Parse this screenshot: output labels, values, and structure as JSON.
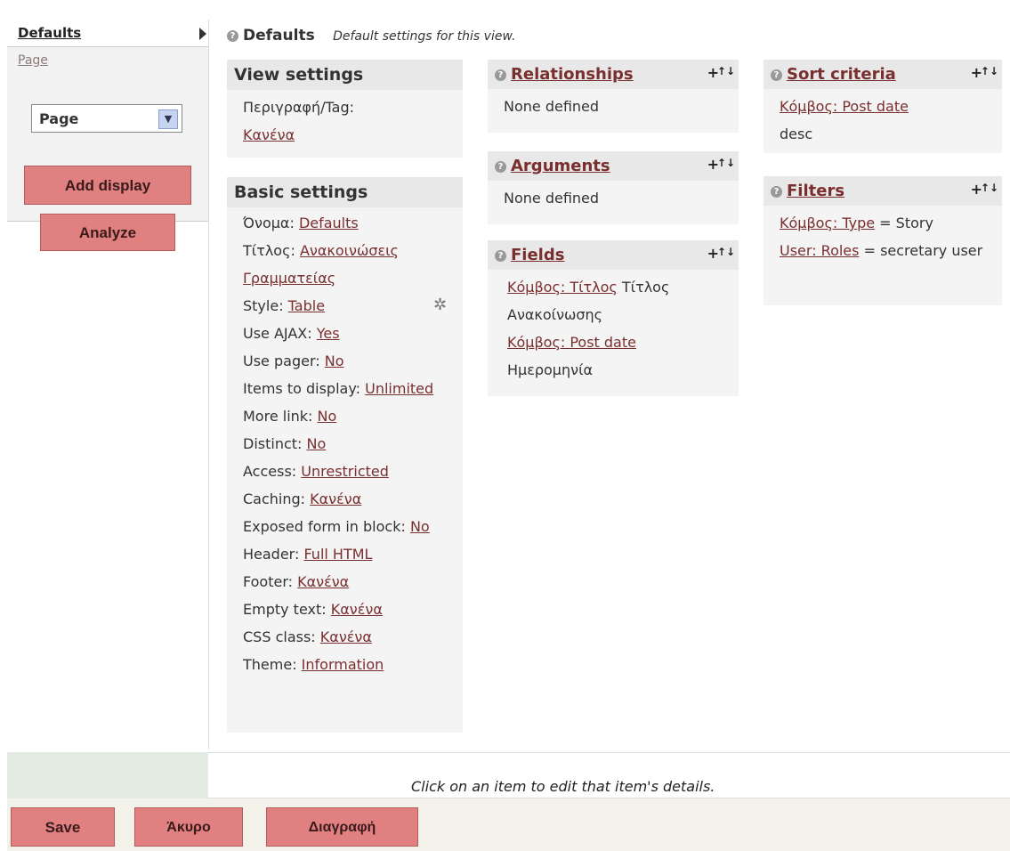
{
  "sidebar": {
    "tabs": [
      "Defaults",
      "Page"
    ],
    "select_value": "Page",
    "add_display_label": "Add display",
    "analyze_label": "Analyze"
  },
  "header": {
    "title": "Defaults",
    "description": "Default settings for this view."
  },
  "view_settings": {
    "title": "View settings",
    "label": "Περιγραφή/Tag:",
    "value": "Κανένα"
  },
  "basic_settings": {
    "title": "Basic settings",
    "items": [
      {
        "label": "Όνομα:",
        "value": "Defaults"
      },
      {
        "label": "Τίτλος:",
        "value": "Ανακοινώσεις Γραμματείας"
      },
      {
        "label": "Style:",
        "value": "Table"
      },
      {
        "label": "Use AJAX:",
        "value": "Yes"
      },
      {
        "label": "Use pager:",
        "value": "No"
      },
      {
        "label": "Items to display:",
        "value": "Unlimited"
      },
      {
        "label": "More link:",
        "value": "No"
      },
      {
        "label": "Distinct:",
        "value": "No"
      },
      {
        "label": "Access:",
        "value": "Unrestricted"
      },
      {
        "label": "Caching:",
        "value": "Κανένα"
      },
      {
        "label": "Exposed form in block:",
        "value": "No"
      },
      {
        "label": "Header:",
        "value": "Full HTML"
      },
      {
        "label": "Footer:",
        "value": "Κανένα"
      },
      {
        "label": "Empty text:",
        "value": "Κανένα"
      },
      {
        "label": "CSS class:",
        "value": "Κανένα"
      },
      {
        "label": "Theme:",
        "value": "Information"
      }
    ]
  },
  "relationships": {
    "title": "Relationships",
    "body": "None defined"
  },
  "arguments": {
    "title": "Arguments",
    "body": "None defined"
  },
  "fields": {
    "title": "Fields",
    "items": [
      {
        "link": "Κόμβος: Τίτλος",
        "text": "Τίτλος Ανακοίνωσης"
      },
      {
        "link": "Κόμβος: Post date",
        "text": "Ημερομηνία"
      }
    ]
  },
  "sort_criteria": {
    "title": "Sort criteria",
    "link": "Κόμβος: Post date",
    "text": "desc"
  },
  "filters": {
    "title": "Filters",
    "items": [
      {
        "link": "Κόμβος: Type",
        "text": "= Story"
      },
      {
        "link": "User: Roles",
        "text": "= secretary user"
      }
    ]
  },
  "footer_hint": "Click on an item to edit that item's details.",
  "buttons": {
    "save": "Save",
    "cancel": "Άκυρο",
    "delete": "Διαγραφή"
  }
}
